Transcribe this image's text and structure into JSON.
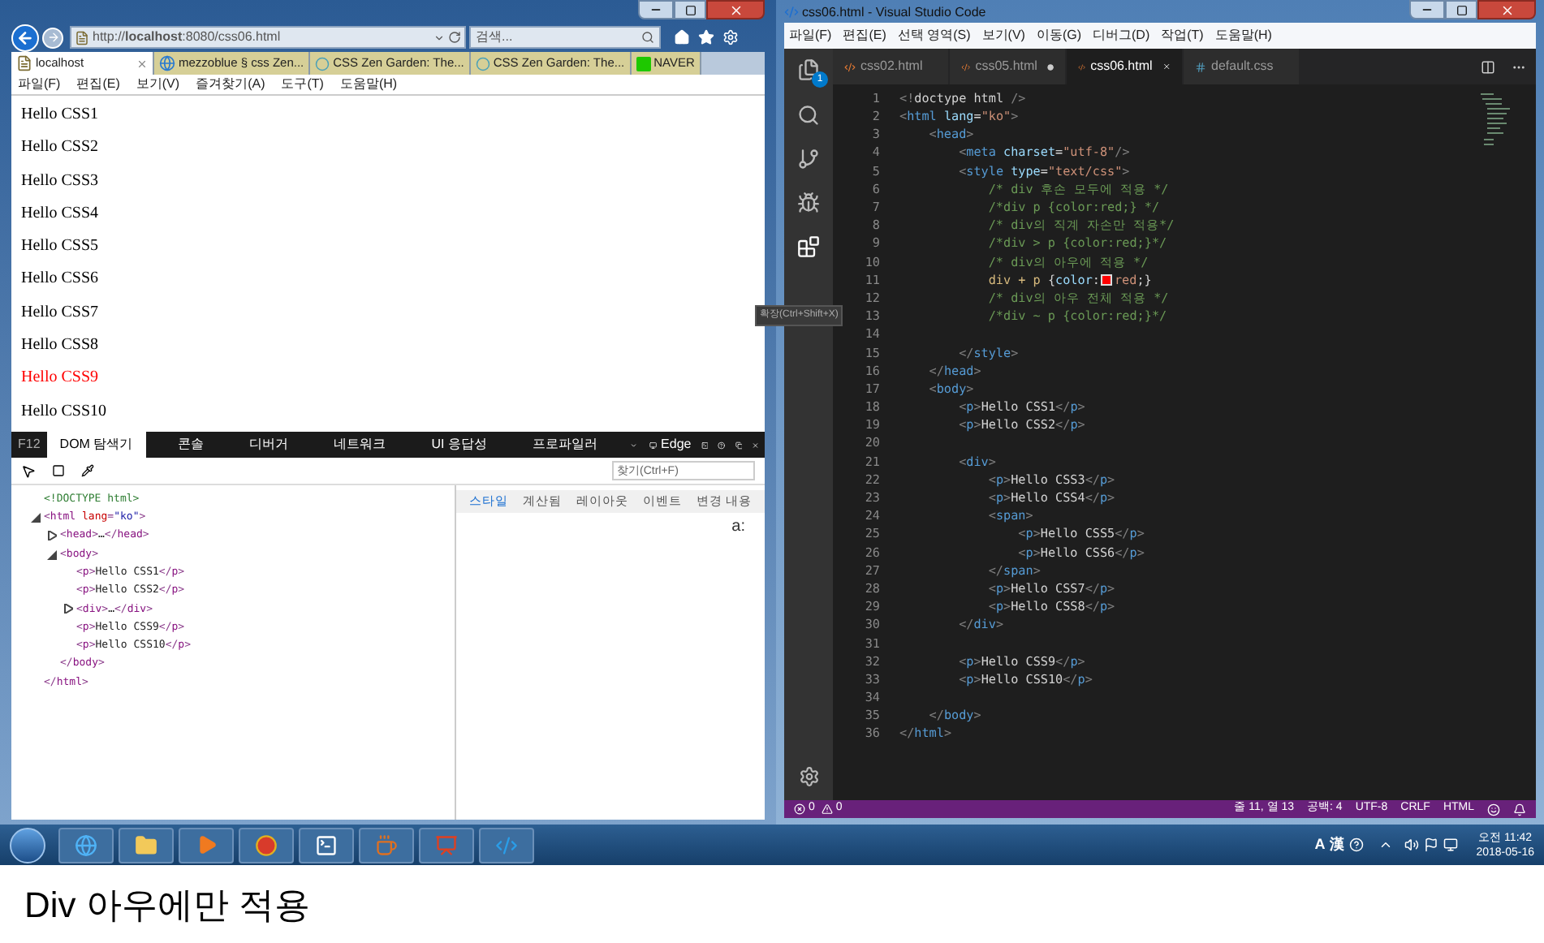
{
  "browser": {
    "address": "http://**localhost**:8080/css06.html",
    "search": {
      "placeholder": "검색..."
    },
    "tabs": [
      {
        "label": "localhost",
        "kind": "page",
        "selected": true
      },
      {
        "label": "mezzoblue § css Zen...",
        "kind": "site",
        "selected": false
      },
      {
        "label": "CSS Zen Garden: The...",
        "kind": "loading",
        "selected": false
      },
      {
        "label": "CSS Zen Garden: The...",
        "kind": "loading",
        "selected": false
      },
      {
        "label": "NAVER",
        "kind": "naver",
        "selected": false
      }
    ],
    "menu": [
      "파일(F)",
      "편집(E)",
      "보기(V)",
      "즐겨찾기(A)",
      "도구(T)",
      "도움말(H)"
    ],
    "page_lines": [
      {
        "text": "Hello CSS1",
        "color": "#000000"
      },
      {
        "text": "Hello CSS2",
        "color": "#000000"
      },
      {
        "text": "Hello CSS3",
        "color": "#000000"
      },
      {
        "text": "Hello CSS4",
        "color": "#000000"
      },
      {
        "text": "Hello CSS5",
        "color": "#000000"
      },
      {
        "text": "Hello CSS6",
        "color": "#000000"
      },
      {
        "text": "Hello CSS7",
        "color": "#000000"
      },
      {
        "text": "Hello CSS8",
        "color": "#000000"
      },
      {
        "text": "Hello CSS9",
        "color": "#ff0000"
      },
      {
        "text": "Hello CSS10",
        "color": "#000000"
      }
    ]
  },
  "devtools": {
    "f12_label": "F12",
    "tabs": [
      {
        "label": "DOM 탐색기",
        "selected": true
      },
      {
        "label": "콘솔",
        "selected": false
      },
      {
        "label": "디버거",
        "selected": false
      },
      {
        "label": "네트워크",
        "selected": false
      },
      {
        "label": "UI 응답성",
        "selected": false
      },
      {
        "label": "프로파일러",
        "selected": false
      }
    ],
    "emulation_label": "Edge",
    "find": {
      "placeholder": "찾기(Ctrl+F)"
    },
    "dom_tree": [
      {
        "tokens": [
          {
            "kind": "doctype",
            "text": "<!DOCTYPE html>"
          }
        ]
      },
      {
        "expanded": true,
        "tokens": [
          {
            "kind": "punct",
            "text": "<"
          },
          {
            "kind": "tag",
            "text": "html"
          },
          {
            "kind": "attr",
            "text": " lang"
          },
          {
            "kind": "punct",
            "text": "="
          },
          {
            "kind": "str",
            "text": "\"ko\""
          },
          {
            "kind": "punct",
            "text": ">"
          }
        ],
        "children": [
          {
            "expanded": false,
            "tokens": [
              {
                "kind": "punct",
                "text": "<"
              },
              {
                "kind": "tag",
                "text": "head"
              },
              {
                "kind": "punct",
                "text": ">"
              },
              {
                "kind": "text",
                "text": "…"
              },
              {
                "kind": "punct",
                "text": "</"
              },
              {
                "kind": "tag",
                "text": "head"
              },
              {
                "kind": "punct",
                "text": ">"
              }
            ]
          },
          {
            "expanded": true,
            "tokens": [
              {
                "kind": "punct",
                "text": "<"
              },
              {
                "kind": "tag",
                "text": "body"
              },
              {
                "kind": "punct",
                "text": ">"
              }
            ],
            "children": [
              {
                "tokens": [
                  {
                    "kind": "punct",
                    "text": "<"
                  },
                  {
                    "kind": "tag",
                    "text": "p"
                  },
                  {
                    "kind": "punct",
                    "text": ">"
                  },
                  {
                    "kind": "text",
                    "text": "Hello CSS1"
                  },
                  {
                    "kind": "punct",
                    "text": "</"
                  },
                  {
                    "kind": "tag",
                    "text": "p"
                  },
                  {
                    "kind": "punct",
                    "text": ">"
                  }
                ]
              },
              {
                "tokens": [
                  {
                    "kind": "punct",
                    "text": "<"
                  },
                  {
                    "kind": "tag",
                    "text": "p"
                  },
                  {
                    "kind": "punct",
                    "text": ">"
                  },
                  {
                    "kind": "text",
                    "text": "Hello CSS2"
                  },
                  {
                    "kind": "punct",
                    "text": "</"
                  },
                  {
                    "kind": "tag",
                    "text": "p"
                  },
                  {
                    "kind": "punct",
                    "text": ">"
                  }
                ]
              },
              {
                "expanded": false,
                "tokens": [
                  {
                    "kind": "punct",
                    "text": "<"
                  },
                  {
                    "kind": "tag",
                    "text": "div"
                  },
                  {
                    "kind": "punct",
                    "text": ">"
                  },
                  {
                    "kind": "text",
                    "text": "…"
                  },
                  {
                    "kind": "punct",
                    "text": "</"
                  },
                  {
                    "kind": "tag",
                    "text": "div"
                  },
                  {
                    "kind": "punct",
                    "text": ">"
                  }
                ]
              },
              {
                "tokens": [
                  {
                    "kind": "punct",
                    "text": "<"
                  },
                  {
                    "kind": "tag",
                    "text": "p"
                  },
                  {
                    "kind": "punct",
                    "text": ">"
                  },
                  {
                    "kind": "text",
                    "text": "Hello CSS9"
                  },
                  {
                    "kind": "punct",
                    "text": "</"
                  },
                  {
                    "kind": "tag",
                    "text": "p"
                  },
                  {
                    "kind": "punct",
                    "text": ">"
                  }
                ]
              },
              {
                "tokens": [
                  {
                    "kind": "punct",
                    "text": "<"
                  },
                  {
                    "kind": "tag",
                    "text": "p"
                  },
                  {
                    "kind": "punct",
                    "text": ">"
                  },
                  {
                    "kind": "text",
                    "text": "Hello CSS10"
                  },
                  {
                    "kind": "punct",
                    "text": "</"
                  },
                  {
                    "kind": "tag",
                    "text": "p"
                  },
                  {
                    "kind": "punct",
                    "text": ">"
                  }
                ]
              }
            ],
            "closing": [
              {
                "kind": "punct",
                "text": "</"
              },
              {
                "kind": "tag",
                "text": "body"
              },
              {
                "kind": "punct",
                "text": ">"
              }
            ]
          }
        ],
        "closing": [
          {
            "kind": "punct",
            "text": "</"
          },
          {
            "kind": "tag",
            "text": "html"
          },
          {
            "kind": "punct",
            "text": ">"
          }
        ]
      }
    ],
    "style_tabs": [
      {
        "label": "스타일",
        "selected": true
      },
      {
        "label": "계산됨",
        "selected": false
      },
      {
        "label": "레이아웃",
        "selected": false
      },
      {
        "label": "이벤트",
        "selected": false
      },
      {
        "label": "변경 내용",
        "selected": false
      }
    ],
    "style_pane_text": "a:"
  },
  "vscode": {
    "title": "css06.html - Visual Studio Code",
    "menu": [
      "파일(F)",
      "편집(E)",
      "선택 영역(S)",
      "보기(V)",
      "이동(G)",
      "디버그(D)",
      "작업(T)",
      "도움말(H)"
    ],
    "explorer_badge": "1",
    "tooltip": "확장(Ctrl+Shift+X)",
    "tabs": [
      {
        "label": "css02.html",
        "kind": "html",
        "selected": false,
        "modified": false
      },
      {
        "label": "css05.html",
        "kind": "html",
        "selected": false,
        "modified": true
      },
      {
        "label": "css06.html",
        "kind": "html",
        "selected": true,
        "modified": false
      },
      {
        "label": "default.css",
        "kind": "css",
        "selected": false,
        "modified": false
      }
    ],
    "lines": [
      {
        "number": "1",
        "tokens": [
          {
            "kind": "punct",
            "text": "<!"
          },
          {
            "kind": "text",
            "text": "doctype html"
          },
          {
            "kind": "punct",
            "text": " />"
          }
        ]
      },
      {
        "number": "2",
        "tokens": [
          {
            "kind": "punct",
            "text": "<"
          },
          {
            "kind": "tag",
            "text": "html"
          },
          {
            "kind": "attr",
            "text": " lang"
          },
          {
            "kind": "text",
            "text": "="
          },
          {
            "kind": "str",
            "text": "\"ko\""
          },
          {
            "kind": "punct",
            "text": ">"
          }
        ]
      },
      {
        "number": "3",
        "tokens": [
          {
            "kind": "punct",
            "text": "    <"
          },
          {
            "kind": "tag",
            "text": "head"
          },
          {
            "kind": "punct",
            "text": ">"
          }
        ]
      },
      {
        "number": "4",
        "tokens": [
          {
            "kind": "punct",
            "text": "        <"
          },
          {
            "kind": "tag",
            "text": "meta"
          },
          {
            "kind": "attr",
            "text": " charset"
          },
          {
            "kind": "text",
            "text": "="
          },
          {
            "kind": "str",
            "text": "\"utf-8\""
          },
          {
            "kind": "punct",
            "text": "/>"
          }
        ]
      },
      {
        "number": "5",
        "tokens": [
          {
            "kind": "punct",
            "text": "        <"
          },
          {
            "kind": "tag",
            "text": "style"
          },
          {
            "kind": "attr",
            "text": " type"
          },
          {
            "kind": "text",
            "text": "="
          },
          {
            "kind": "str",
            "text": "\"text/css\""
          },
          {
            "kind": "punct",
            "text": ">"
          }
        ]
      },
      {
        "number": "6",
        "tokens": [
          {
            "kind": "comment",
            "text": "            /* div 후손 모두에 적용 */"
          }
        ]
      },
      {
        "number": "7",
        "tokens": [
          {
            "kind": "comment",
            "text": "            /*div p {color:red;} */"
          }
        ]
      },
      {
        "number": "8",
        "tokens": [
          {
            "kind": "comment",
            "text": "            /* div의 직계 자손만 적용*/"
          }
        ]
      },
      {
        "number": "9",
        "tokens": [
          {
            "kind": "comment",
            "text": "            /*div > p {color:red;}*/"
          }
        ]
      },
      {
        "number": "10",
        "tokens": [
          {
            "kind": "comment",
            "text": "            /* div의 아우에 적용 */"
          }
        ]
      },
      {
        "number": "11",
        "tokens": [
          {
            "kind": "sel",
            "text": "            div + p"
          },
          {
            "kind": "text",
            "text": " {"
          },
          {
            "kind": "attr",
            "text": "color"
          },
          {
            "kind": "text",
            "text": ":"
          },
          {
            "kind": "swatch",
            "color": "#ff0000"
          },
          {
            "kind": "str",
            "text": "red"
          },
          {
            "kind": "text",
            "text": ";}"
          }
        ]
      },
      {
        "number": "12",
        "tokens": [
          {
            "kind": "comment",
            "text": "            /* div의 아우 전체 적용 */"
          }
        ]
      },
      {
        "number": "13",
        "tokens": [
          {
            "kind": "comment",
            "text": "            /*div ~ p {color:red;}*/"
          }
        ]
      },
      {
        "number": "14"
      },
      {
        "number": "15",
        "tokens": [
          {
            "kind": "punct",
            "text": "        </"
          },
          {
            "kind": "tag",
            "text": "style"
          },
          {
            "kind": "punct",
            "text": ">"
          }
        ]
      },
      {
        "number": "16",
        "tokens": [
          {
            "kind": "punct",
            "text": "    </"
          },
          {
            "kind": "tag",
            "text": "head"
          },
          {
            "kind": "punct",
            "text": ">"
          }
        ]
      },
      {
        "number": "17",
        "tokens": [
          {
            "kind": "punct",
            "text": "    <"
          },
          {
            "kind": "tag",
            "text": "body"
          },
          {
            "kind": "punct",
            "text": ">"
          }
        ]
      },
      {
        "number": "18",
        "tokens": [
          {
            "kind": "punct",
            "text": "        <"
          },
          {
            "kind": "tag",
            "text": "p"
          },
          {
            "kind": "punct",
            "text": ">"
          },
          {
            "kind": "text",
            "text": "Hello CSS1"
          },
          {
            "kind": "punct",
            "text": "</"
          },
          {
            "kind": "tag",
            "text": "p"
          },
          {
            "kind": "punct",
            "text": ">"
          }
        ]
      },
      {
        "number": "19",
        "tokens": [
          {
            "kind": "punct",
            "text": "        <"
          },
          {
            "kind": "tag",
            "text": "p"
          },
          {
            "kind": "punct",
            "text": ">"
          },
          {
            "kind": "text",
            "text": "Hello CSS2"
          },
          {
            "kind": "punct",
            "text": "</"
          },
          {
            "kind": "tag",
            "text": "p"
          },
          {
            "kind": "punct",
            "text": ">"
          }
        ]
      },
      {
        "number": "20"
      },
      {
        "number": "21",
        "tokens": [
          {
            "kind": "punct",
            "text": "        <"
          },
          {
            "kind": "tag",
            "text": "div"
          },
          {
            "kind": "punct",
            "text": ">"
          }
        ]
      },
      {
        "number": "22",
        "tokens": [
          {
            "kind": "punct",
            "text": "            <"
          },
          {
            "kind": "tag",
            "text": "p"
          },
          {
            "kind": "punct",
            "text": ">"
          },
          {
            "kind": "text",
            "text": "Hello CSS3"
          },
          {
            "kind": "punct",
            "text": "</"
          },
          {
            "kind": "tag",
            "text": "p"
          },
          {
            "kind": "punct",
            "text": ">"
          }
        ]
      },
      {
        "number": "23",
        "tokens": [
          {
            "kind": "punct",
            "text": "            <"
          },
          {
            "kind": "tag",
            "text": "p"
          },
          {
            "kind": "punct",
            "text": ">"
          },
          {
            "kind": "text",
            "text": "Hello CSS4"
          },
          {
            "kind": "punct",
            "text": "</"
          },
          {
            "kind": "tag",
            "text": "p"
          },
          {
            "kind": "punct",
            "text": ">"
          }
        ]
      },
      {
        "number": "24",
        "tokens": [
          {
            "kind": "punct",
            "text": "            <"
          },
          {
            "kind": "tag",
            "text": "span"
          },
          {
            "kind": "punct",
            "text": ">"
          }
        ]
      },
      {
        "number": "25",
        "tokens": [
          {
            "kind": "punct",
            "text": "                <"
          },
          {
            "kind": "tag",
            "text": "p"
          },
          {
            "kind": "punct",
            "text": ">"
          },
          {
            "kind": "text",
            "text": "Hello CSS5"
          },
          {
            "kind": "punct",
            "text": "</"
          },
          {
            "kind": "tag",
            "text": "p"
          },
          {
            "kind": "punct",
            "text": ">"
          }
        ]
      },
      {
        "number": "26",
        "tokens": [
          {
            "kind": "punct",
            "text": "                <"
          },
          {
            "kind": "tag",
            "text": "p"
          },
          {
            "kind": "punct",
            "text": ">"
          },
          {
            "kind": "text",
            "text": "Hello CSS6"
          },
          {
            "kind": "punct",
            "text": "</"
          },
          {
            "kind": "tag",
            "text": "p"
          },
          {
            "kind": "punct",
            "text": ">"
          }
        ]
      },
      {
        "number": "27",
        "tokens": [
          {
            "kind": "punct",
            "text": "            </"
          },
          {
            "kind": "tag",
            "text": "span"
          },
          {
            "kind": "punct",
            "text": ">"
          }
        ]
      },
      {
        "number": "28",
        "tokens": [
          {
            "kind": "punct",
            "text": "            <"
          },
          {
            "kind": "tag",
            "text": "p"
          },
          {
            "kind": "punct",
            "text": ">"
          },
          {
            "kind": "text",
            "text": "Hello CSS7"
          },
          {
            "kind": "punct",
            "text": "</"
          },
          {
            "kind": "tag",
            "text": "p"
          },
          {
            "kind": "punct",
            "text": ">"
          }
        ]
      },
      {
        "number": "29",
        "tokens": [
          {
            "kind": "punct",
            "text": "            <"
          },
          {
            "kind": "tag",
            "text": "p"
          },
          {
            "kind": "punct",
            "text": ">"
          },
          {
            "kind": "text",
            "text": "Hello CSS8"
          },
          {
            "kind": "punct",
            "text": "</"
          },
          {
            "kind": "tag",
            "text": "p"
          },
          {
            "kind": "punct",
            "text": ">"
          }
        ]
      },
      {
        "number": "30",
        "tokens": [
          {
            "kind": "punct",
            "text": "        </"
          },
          {
            "kind": "tag",
            "text": "div"
          },
          {
            "kind": "punct",
            "text": ">"
          }
        ]
      },
      {
        "number": "31"
      },
      {
        "number": "32",
        "tokens": [
          {
            "kind": "punct",
            "text": "        <"
          },
          {
            "kind": "tag",
            "text": "p"
          },
          {
            "kind": "punct",
            "text": ">"
          },
          {
            "kind": "text",
            "text": "Hello CSS9"
          },
          {
            "kind": "punct",
            "text": "</"
          },
          {
            "kind": "tag",
            "text": "p"
          },
          {
            "kind": "punct",
            "text": ">"
          }
        ]
      },
      {
        "number": "33",
        "tokens": [
          {
            "kind": "punct",
            "text": "        <"
          },
          {
            "kind": "tag",
            "text": "p"
          },
          {
            "kind": "punct",
            "text": ">"
          },
          {
            "kind": "text",
            "text": "Hello CSS10"
          },
          {
            "kind": "punct",
            "text": "</"
          },
          {
            "kind": "tag",
            "text": "p"
          },
          {
            "kind": "punct",
            "text": ">"
          }
        ]
      },
      {
        "number": "34"
      },
      {
        "number": "35",
        "tokens": [
          {
            "kind": "punct",
            "text": "    </"
          },
          {
            "kind": "tag",
            "text": "body"
          },
          {
            "kind": "punct",
            "text": ">"
          }
        ]
      },
      {
        "number": "36",
        "tokens": [
          {
            "kind": "punct",
            "text": "</"
          },
          {
            "kind": "tag",
            "text": "html"
          },
          {
            "kind": "punct",
            "text": ">"
          }
        ]
      }
    ],
    "status": {
      "errors": "0",
      "warnings": "0",
      "position": "줄 11, 열 13",
      "spaces": "공백: 4",
      "encoding": "UTF-8",
      "line_ending": "CRLF",
      "language": "HTML"
    }
  },
  "taskbar": {
    "ime": [
      "A",
      "漢"
    ],
    "time": "오전 11:42",
    "date": "2018-05-16"
  },
  "caption": "Div 아우에만 적용"
}
